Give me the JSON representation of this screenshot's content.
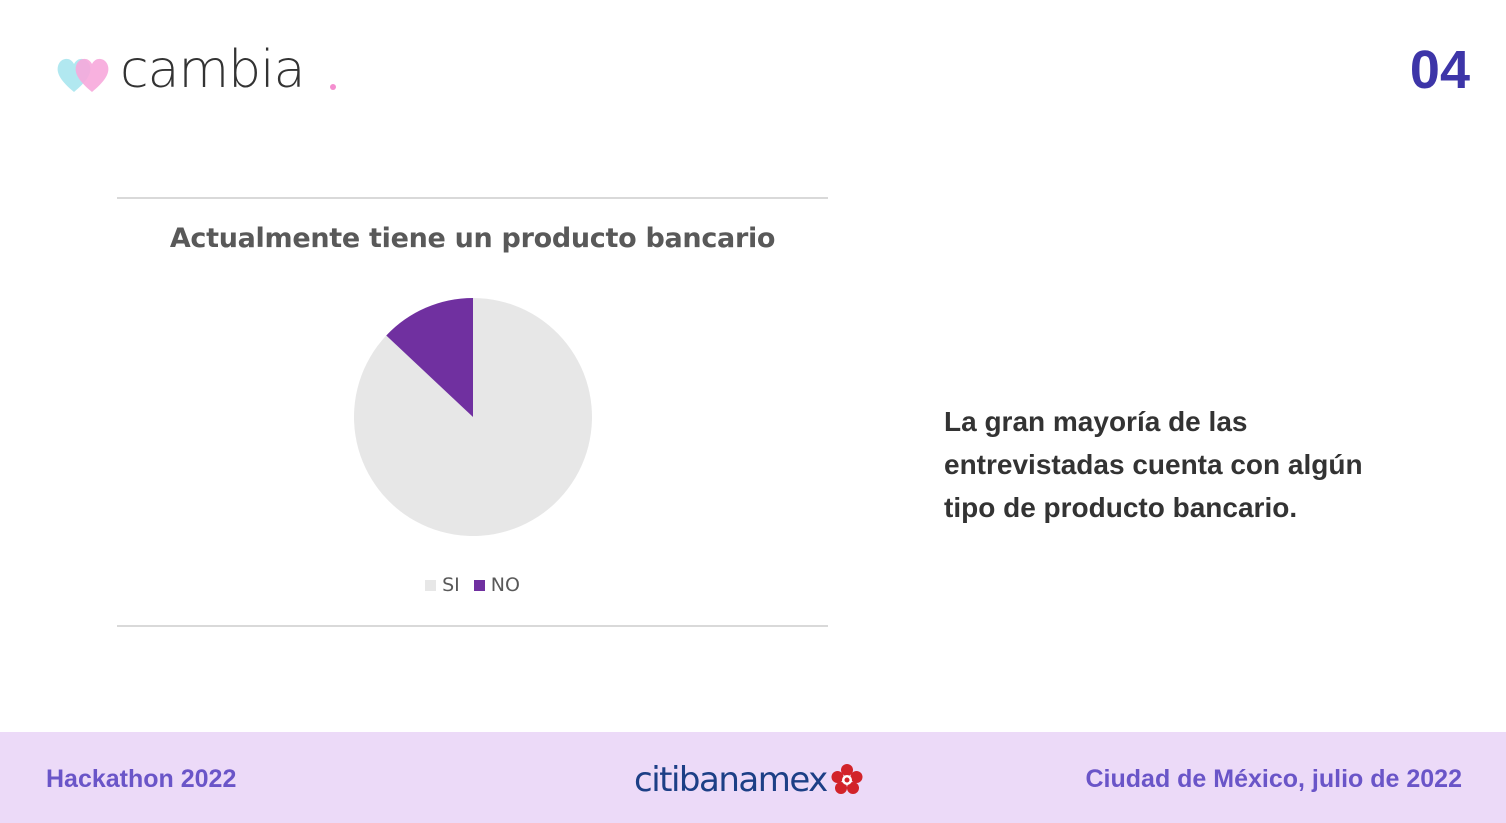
{
  "brand": {
    "name": "cambia",
    "colors": {
      "heart_blue": "#a8e6ee",
      "heart_pink": "#f7a8dc",
      "dot": "#f48ecf"
    }
  },
  "page_number": "04",
  "chart_data": {
    "type": "pie",
    "title": "Actualmente tiene un producto bancario",
    "categories": [
      "SI",
      "NO"
    ],
    "values": [
      87,
      13
    ],
    "colors": [
      "#e7e7e7",
      "#7030a0"
    ],
    "legend": "bottom",
    "grid": false
  },
  "insight": "La gran mayoría de las entrevistadas cuenta con algún tipo de producto bancario.",
  "footer": {
    "event": "Hackathon 2022",
    "sponsor": "citibanamex",
    "location_date": "Ciudad de México, julio de 2022",
    "colors": {
      "background": "#ecdaf8",
      "text": "#6a55c8",
      "sponsor_text": "#1c3f86",
      "sponsor_icon": "#d2232a"
    },
    "sponsor_icon": "flower-icon"
  }
}
